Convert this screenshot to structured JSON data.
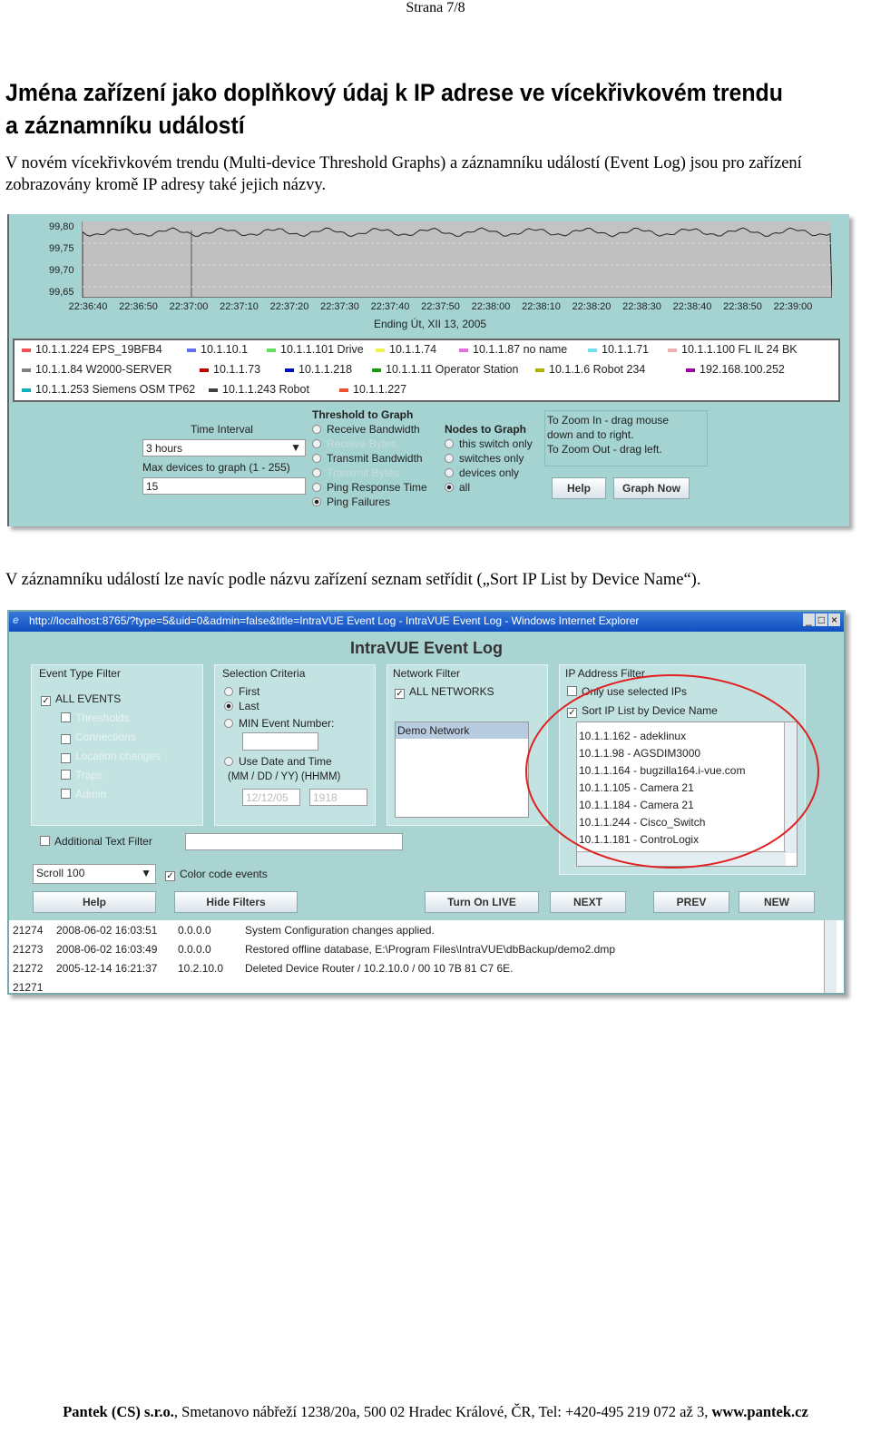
{
  "page_header": "Strana 7/8",
  "heading": "Jména zařízení jako doplňkový údaj k IP adrese ve vícekřivkovém trendu a záznamníku událostí",
  "para1": "V novém vícekřivkovém trendu (Multi-device Threshold Graphs) a záznamníku událostí (Event Log) jsou pro zařízení zobrazovány kromě IP adresy také jejich názvy.",
  "para2": "V záznamníku událostí lze navíc podle názvu zařízení seznam setřídit („Sort IP List by Device Name“).",
  "graph": {
    "y_ticks": [
      "99,80",
      "99,75",
      "99,70",
      "99,65"
    ],
    "x_ticks": [
      "22:36:40",
      "22:36:50",
      "22:37:00",
      "22:37:10",
      "22:37:20",
      "22:37:30",
      "22:37:40",
      "22:37:50",
      "22:38:00",
      "22:38:10",
      "22:38:20",
      "22:38:30",
      "22:38:40",
      "22:38:50",
      "22:39:00"
    ],
    "ending": "Ending Út, XII 13, 2005",
    "legend": [
      [
        {
          "t": "10.1.1.224 EPS_19BFB4",
          "c": "#f05050"
        },
        {
          "t": "10.1.10.1",
          "c": "#6070f0"
        },
        {
          "t": "10.1.1.101 Drive",
          "c": "#60e060"
        },
        {
          "t": "10.1.1.74",
          "c": "#f0f050"
        },
        {
          "t": "10.1.1.87 no name",
          "c": "#e070e0"
        },
        {
          "t": "10.1.1.71",
          "c": "#70e0f0"
        },
        {
          "t": "10.1.1.100 FL IL 24 BK",
          "c": "#f0b0b0"
        }
      ],
      [
        {
          "t": "10.1.1.84 W2000-SERVER",
          "c": "#808080"
        },
        {
          "t": "10.1.1.73",
          "c": "#c00000"
        },
        {
          "t": "10.1.1.218",
          "c": "#0010c0"
        },
        {
          "t": "10.1.1.11 Operator Station",
          "c": "#10a010"
        },
        {
          "t": "10.1.1.6 Robot 234",
          "c": "#b0b000"
        },
        {
          "t": "192.168.100.252",
          "c": "#a000a0"
        }
      ],
      [
        {
          "t": "10.1.1.253 Siemens OSM TP62",
          "c": "#10b0c0"
        },
        {
          "t": "10.1.1.243 Robot",
          "c": "#404040"
        },
        {
          "t": "10.1.1.227",
          "c": "#f05030"
        }
      ]
    ],
    "time_interval_label": "Time Interval",
    "time_interval_value": "3  hours",
    "max_devices_label": "Max devices to graph (1 - 255)",
    "max_devices_value": "15",
    "threshold_label": "Threshold to Graph",
    "threshold_options": [
      {
        "t": "Receive Bandwidth",
        "on": false,
        "dis": false
      },
      {
        "t": "Receive Bytes",
        "on": false,
        "dis": true
      },
      {
        "t": "Transmit Bandwidth",
        "on": false,
        "dis": false
      },
      {
        "t": "Transmit Bytes",
        "on": false,
        "dis": true
      },
      {
        "t": "Ping Response Time",
        "on": false,
        "dis": false
      },
      {
        "t": "Ping Failures",
        "on": true,
        "dis": false
      }
    ],
    "nodes_label": "Nodes to Graph",
    "nodes_options": [
      {
        "t": "this switch only",
        "on": false
      },
      {
        "t": "switches only",
        "on": false
      },
      {
        "t": "devices only",
        "on": false
      },
      {
        "t": "all",
        "on": true
      }
    ],
    "zoom_hint": [
      "To Zoom In - drag mouse",
      "down and to right.",
      "To Zoom Out - drag left."
    ],
    "help": "Help",
    "graph_now": "Graph Now"
  },
  "eventlog": {
    "window_title": "http://localhost:8765/?type=5&uid=0&admin=false&title=IntraVUE Event Log - IntraVUE Event Log - Windows Internet Explorer",
    "app_title": "IntraVUE Event Log",
    "event_type": {
      "label": "Event Type Filter",
      "items": [
        {
          "t": "ALL EVENTS",
          "ck": true,
          "dis": false
        },
        {
          "t": "Thresholds",
          "ck": false,
          "dis": true
        },
        {
          "t": "Connections",
          "ck": true,
          "dis": true
        },
        {
          "t": "Location changes",
          "ck": true,
          "dis": true
        },
        {
          "t": "Traps",
          "ck": false,
          "dis": true
        },
        {
          "t": "Admin",
          "ck": false,
          "dis": true
        }
      ]
    },
    "selection": {
      "label": "Selection Criteria",
      "first": "First",
      "last": "Last",
      "min": "MIN Event Number:",
      "use_date": "Use Date and Time",
      "format": "(MM / DD / YY)    (HHMM)",
      "date": "12/12/05",
      "time": "1918"
    },
    "network": {
      "label": "Network Filter",
      "all": "ALL NETWORKS",
      "items": [
        "Demo Network"
      ]
    },
    "ip": {
      "label": "IP Address Filter",
      "only": "Only use selected IPs",
      "sort": "Sort IP List  by Device Name",
      "items": [
        "10.1.1.162 - adeklinux",
        "10.1.1.98 - AGSDIM3000",
        "10.1.1.164 - bugzilla164.i-vue.com",
        "10.1.1.105 - Camera 21",
        "10.1.1.184 - Camera 21",
        "10.1.1.244 - Cisco_Switch",
        "10.1.1.181 - ControLogix"
      ]
    },
    "additional": "Additional Text Filter",
    "scroll": "Scroll 100",
    "color_code": "Color code events",
    "buttons": [
      "Help",
      "Hide Filters",
      "Turn On LIVE",
      "NEXT",
      "PREV",
      "NEW"
    ],
    "rows": [
      [
        "21274",
        "2008-06-02 16:03:51",
        "0.0.0.0",
        "System Configuration changes applied."
      ],
      [
        "21273",
        "2008-06-02 16:03:49",
        "0.0.0.0",
        "Restored offline database, E:\\Program Files\\IntraVUE\\dbBackup/demo2.dmp"
      ],
      [
        "21272",
        "2005-12-14 16:21:37",
        "10.2.10.0",
        "  Deleted Device Router / 10.2.10.0 / 00 10 7B 81 C7 6E."
      ],
      [
        "21271",
        "",
        "",
        ""
      ]
    ],
    "highlight_color": "#e02020"
  },
  "footer": {
    "company": "Pantek (CS) s.r.o.",
    "address": ", Smetanovo nábřeží 1238/20a, 500 02 Hradec Králové, ČR, Tel: +420-495 219 072 až 3, ",
    "web": "www.pantek.cz"
  }
}
